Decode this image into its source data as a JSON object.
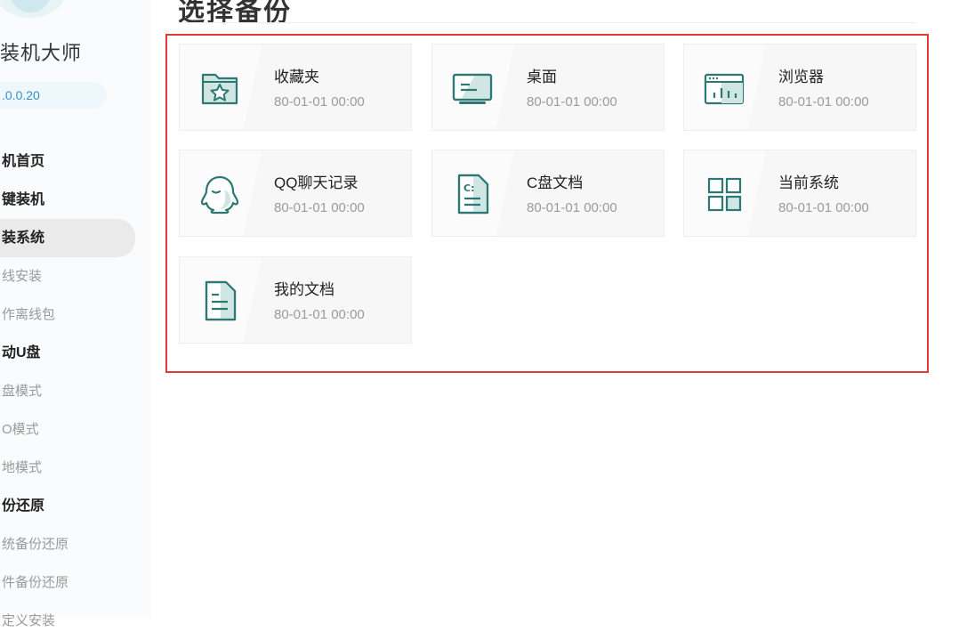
{
  "sidebar": {
    "app_name": "装机大师",
    "version": ".0.0.20",
    "items": [
      {
        "label": "机首页"
      },
      {
        "label": "键装机"
      },
      {
        "label": "装系统"
      },
      {
        "label": "线安装"
      },
      {
        "label": "作离线包"
      },
      {
        "label": "动U盘"
      },
      {
        "label": "盘模式"
      },
      {
        "label": "O模式"
      },
      {
        "label": "地模式"
      },
      {
        "label": "份还原"
      },
      {
        "label": "统备份还原"
      },
      {
        "label": "件备份还原"
      },
      {
        "label": "定义安装"
      }
    ]
  },
  "main": {
    "title": "选择备份",
    "backups": [
      {
        "name": "收藏夹",
        "time": "80-01-01 00:00",
        "icon": "favorites-folder-icon"
      },
      {
        "name": "桌面",
        "time": "80-01-01 00:00",
        "icon": "desktop-icon"
      },
      {
        "name": "浏览器",
        "time": "80-01-01 00:00",
        "icon": "browser-icon"
      },
      {
        "name": "QQ聊天记录",
        "time": "80-01-01 00:00",
        "icon": "qq-icon"
      },
      {
        "name": "C盘文档",
        "time": "80-01-01 00:00",
        "icon": "c-drive-document-icon"
      },
      {
        "name": "当前系统",
        "time": "80-01-01 00:00",
        "icon": "system-grid-icon"
      },
      {
        "name": "我的文档",
        "time": "80-01-01 00:00",
        "icon": "document-icon"
      }
    ]
  },
  "colors": {
    "icon_dark": "#2e7774",
    "icon_fill": "#cfe6e3",
    "highlight": "#e03a3a",
    "active_bg": "#eaeaea"
  }
}
